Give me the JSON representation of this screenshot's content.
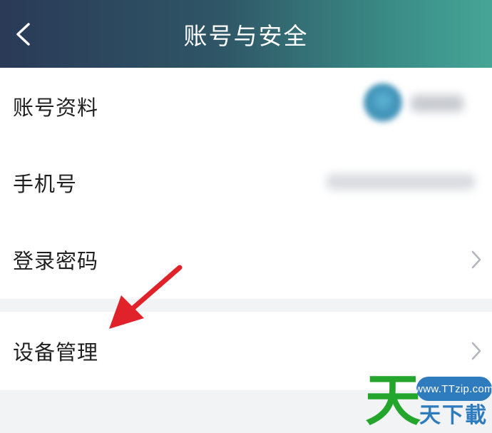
{
  "header": {
    "title": "账号与安全",
    "back_icon": "chevron-left-icon"
  },
  "rows": [
    {
      "label": "账号资料"
    },
    {
      "label": "手机号"
    },
    {
      "label": "登录密码"
    },
    {
      "label": "设备管理"
    }
  ],
  "colors": {
    "header_gradient_start": "#2a3a57",
    "header_gradient_end": "#46a596",
    "arrow": "#e0232a",
    "page_bg": "#f2f3f5",
    "watermark_green": "#24a52c",
    "watermark_blue": "#2e7bbd"
  },
  "watermark": {
    "big_char": "天",
    "chars": "天下載",
    "url": "www.TTzip.com"
  }
}
